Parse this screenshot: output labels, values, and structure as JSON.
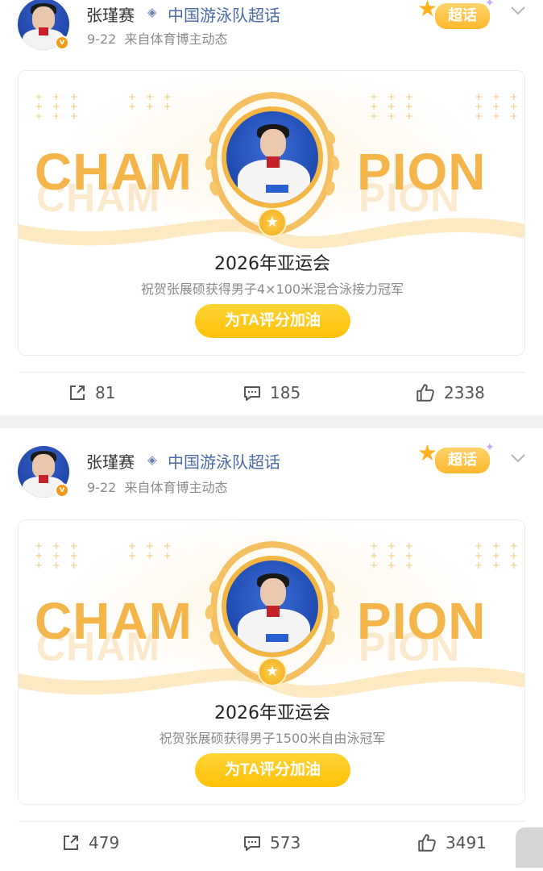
{
  "posts": [
    {
      "user": {
        "name": "张瑾赛",
        "verified_badge": "v"
      },
      "topic": "中国游泳队超话",
      "meta": {
        "date": "9-22",
        "source": "来自体育博主动态"
      },
      "chaohua_label": "超话",
      "card": {
        "banner_left": "CHAM",
        "banner_right": "PION",
        "event": "2026年亚运会",
        "desc": "祝贺张展硕获得男子4×100米混合泳接力冠军",
        "button": "为TA评分加油"
      },
      "actions": {
        "share": "81",
        "comment": "185",
        "like": "2338"
      }
    },
    {
      "user": {
        "name": "张瑾赛",
        "verified_badge": "v"
      },
      "topic": "中国游泳队超话",
      "meta": {
        "date": "9-22",
        "source": "来自体育博主动态"
      },
      "chaohua_label": "超话",
      "card": {
        "banner_left": "CHAM",
        "banner_right": "PION",
        "event": "2026年亚运会",
        "desc": "祝贺张展硕获得男子1500米自由泳冠军",
        "button": "为TA评分加油"
      },
      "actions": {
        "share": "479",
        "comment": "573",
        "like": "3491"
      }
    }
  ],
  "icons": {
    "diamond": "diamond-icon",
    "chevron": "chevron-down-icon",
    "share": "share-icon",
    "comment": "comment-icon",
    "like": "like-icon"
  },
  "colors": {
    "accent_gold": "#f4b54a",
    "button_yellow": "#ffc107",
    "topic_blue": "#4a6aa8",
    "meta_gray": "#8c8c8c"
  }
}
